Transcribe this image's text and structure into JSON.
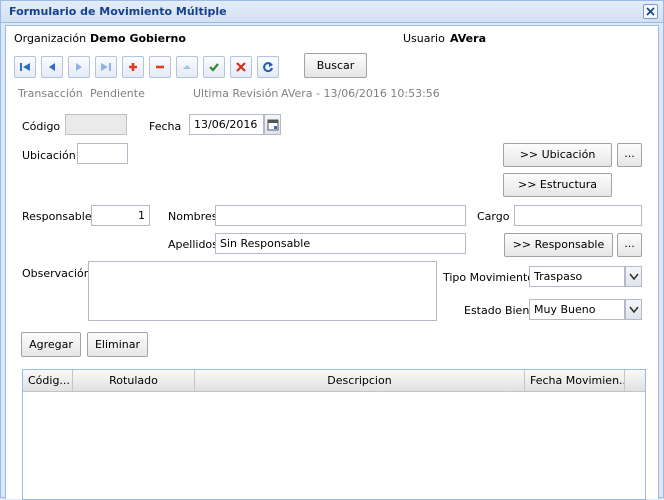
{
  "window": {
    "title": "Formulario de Movimiento Múltiple"
  },
  "header": {
    "org_label": "Organización",
    "org_value": "Demo Gobierno",
    "user_label": "Usuario",
    "user_value": "AVera"
  },
  "toolbar": {
    "search_label": "Buscar",
    "icons": [
      "first-icon",
      "prev-icon",
      "next-icon",
      "last-icon",
      "add-icon",
      "remove-icon",
      "up-icon",
      "confirm-icon",
      "cancel-icon",
      "refresh-icon"
    ]
  },
  "status": {
    "transaction_label": "Transacción",
    "transaction_value": "Pendiente",
    "revision_label": "Ultima Revisión",
    "revision_value": "AVera - 13/06/2016 10:53:56"
  },
  "form": {
    "codigo_label": "Código",
    "codigo_value": "",
    "fecha_label": "Fecha",
    "fecha_value": "13/06/2016",
    "ubicacion_label": "Ubicación",
    "ubicacion_value": "",
    "ubicacion_button": ">> Ubicación",
    "estructura_button": ">> Estructura",
    "ellipsis": "...",
    "responsable_label": "Responsable",
    "responsable_value": "1",
    "nombres_label": "Nombres",
    "nombres_value": "",
    "cargo_label": "Cargo",
    "cargo_value": "",
    "apellidos_label": "Apellidos",
    "apellidos_value": "Sin Responsable",
    "responsable_button": ">> Responsable",
    "observacion_label": "Observación",
    "observacion_value": "",
    "tipo_label": "Tipo Movimiento",
    "tipo_value": "Traspaso",
    "estado_label": "Estado Bien",
    "estado_value": "Muy Bueno"
  },
  "actions": {
    "add_label": "Agregar",
    "delete_label": "Eliminar"
  },
  "grid": {
    "columns": [
      "Códig...",
      "Rotulado",
      "Descripcion",
      "Fecha Movimien..."
    ],
    "rows": []
  },
  "colors": {
    "title": "#15428b",
    "border": "#99bbe8",
    "frame": "#dfe8f6"
  }
}
